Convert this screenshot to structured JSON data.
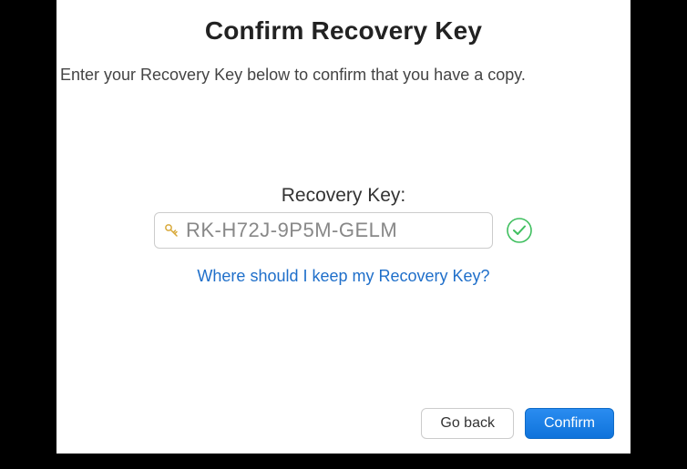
{
  "header": {
    "title": "Confirm Recovery Key",
    "instruction": "Enter your Recovery Key below to confirm that you have a copy."
  },
  "form": {
    "field_label": "Recovery Key:",
    "key_value": "RK-H72J-9P5M-GELM",
    "key_placeholder": "",
    "key_icon": "key-icon",
    "status_icon": "check-circle-icon",
    "validated": true
  },
  "help": {
    "link_text": "Where should I keep my Recovery Key?"
  },
  "footer": {
    "back_label": "Go back",
    "confirm_label": "Confirm"
  },
  "colors": {
    "link": "#1f6fca",
    "primary": "#167ee6",
    "success": "#3fbf5f"
  }
}
